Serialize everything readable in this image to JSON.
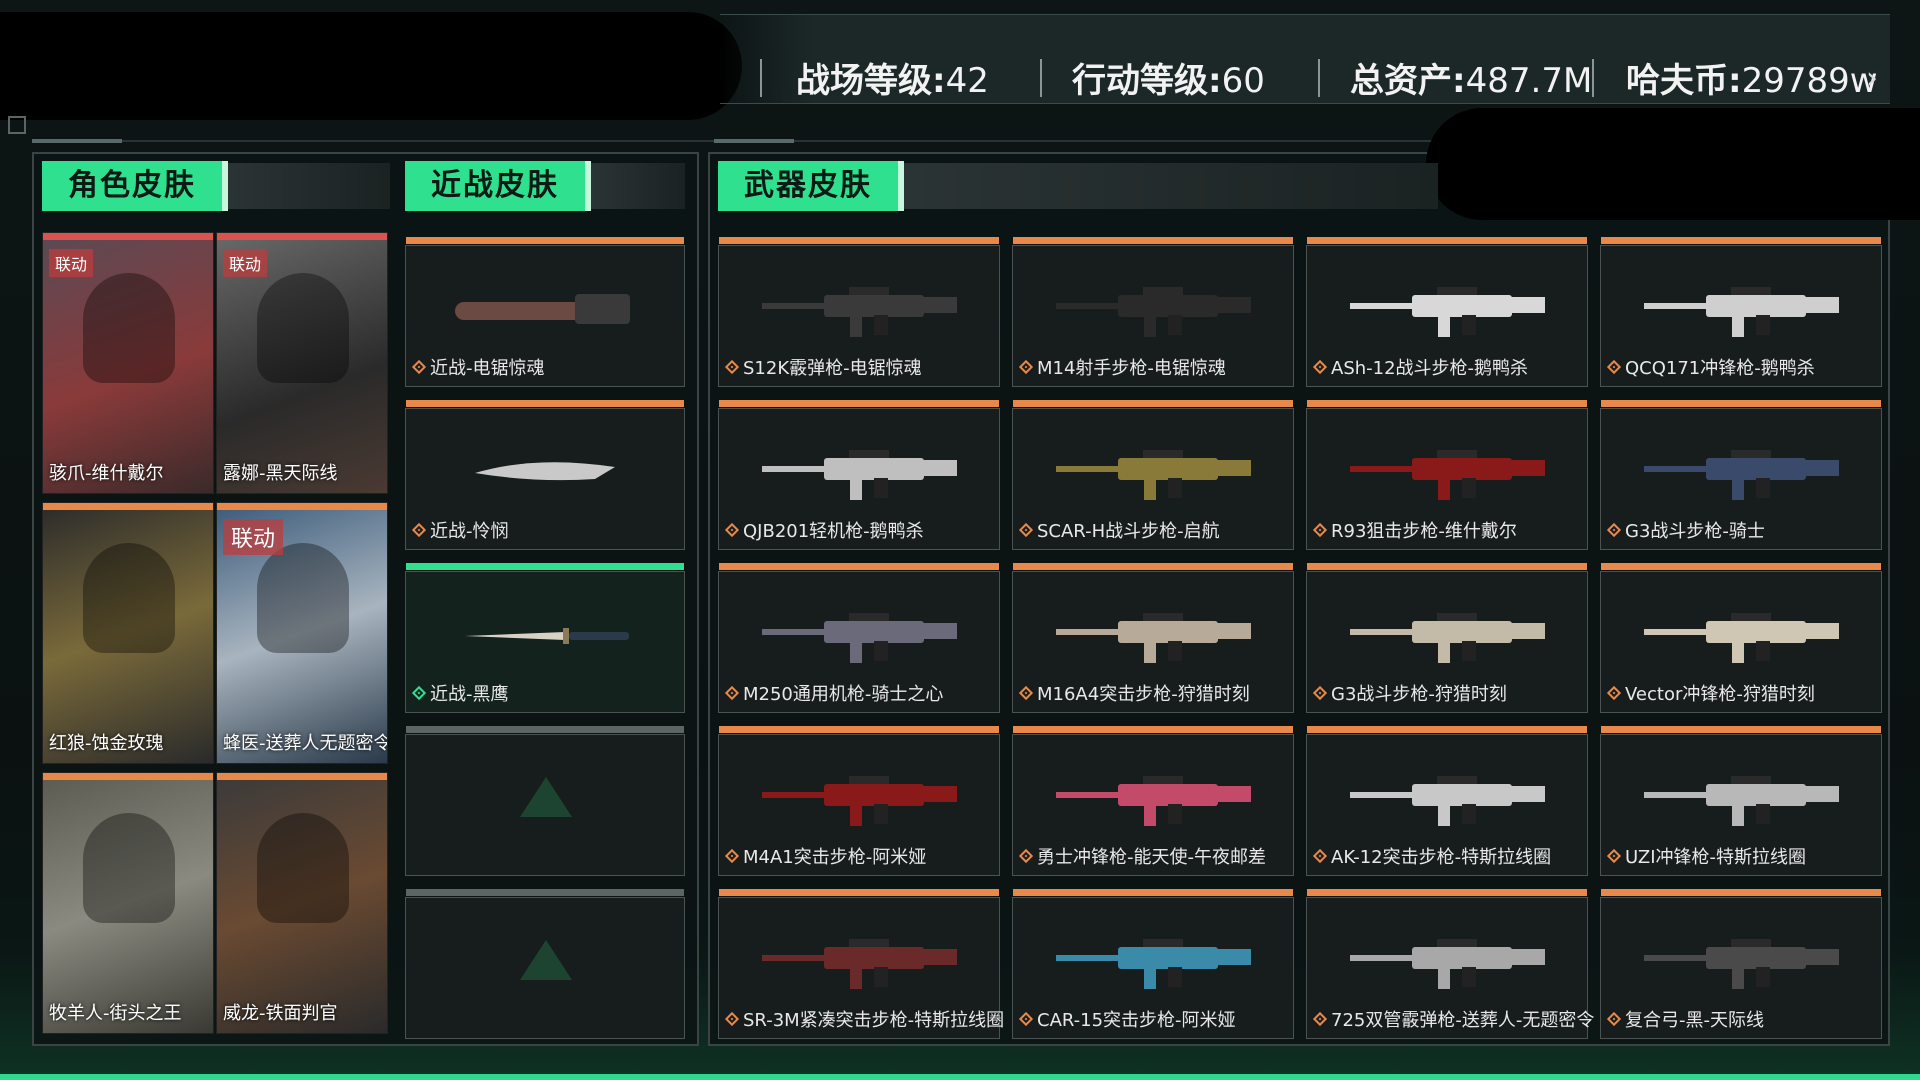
{
  "header": {
    "stats": [
      {
        "label": "战场等级:",
        "value": "42"
      },
      {
        "label": "行动等级:",
        "value": "60"
      },
      {
        "label": "总资产:",
        "value": "487.7M"
      },
      {
        "label": "哈夫币:",
        "value": "29789w"
      }
    ]
  },
  "sections": {
    "character": "角色皮肤",
    "melee": "近战皮肤",
    "weapon": "武器皮肤"
  },
  "colors": {
    "accent": "#2fe08f",
    "rarity_red": "#d9534f",
    "rarity_orange": "#e8894a",
    "rarity_green": "#2fe08f",
    "rarity_gray": "#5c6464"
  },
  "characters": [
    {
      "name": "骇爪-维什戴尔",
      "badge": "联动",
      "rarity": "red"
    },
    {
      "name": "露娜-黑天际线",
      "badge": "联动",
      "rarity": "red"
    },
    {
      "name": "红狼-蚀金玫瑰",
      "badge": "",
      "rarity": "orange"
    },
    {
      "name": "蜂医-送葬人无题密令",
      "badge": "联动",
      "rarity": "orange"
    },
    {
      "name": "牧羊人-街头之王",
      "badge": "",
      "rarity": "orange"
    },
    {
      "name": "威龙-铁面判官",
      "badge": "",
      "rarity": "orange"
    }
  ],
  "melee": [
    {
      "name": "近战-电锯惊魂",
      "rarity": "orange"
    },
    {
      "name": "近战-怜悯",
      "rarity": "orange"
    },
    {
      "name": "近战-黑鹰",
      "rarity": "green"
    },
    {
      "name": "",
      "rarity": "gray"
    },
    {
      "name": "",
      "rarity": "gray"
    }
  ],
  "weapons": [
    {
      "name": "S12K霰弹枪-电锯惊魂"
    },
    {
      "name": "M14射手步枪-电锯惊魂"
    },
    {
      "name": "ASh-12战斗步枪-鹅鸭杀"
    },
    {
      "name": "QCQ171冲锋枪-鹅鸭杀"
    },
    {
      "name": "QJB201轻机枪-鹅鸭杀"
    },
    {
      "name": "SCAR-H战斗步枪-启航"
    },
    {
      "name": "R93狙击步枪-维什戴尔"
    },
    {
      "name": "G3战斗步枪-骑士"
    },
    {
      "name": "M250通用机枪-骑士之心"
    },
    {
      "name": "M16A4突击步枪-狩猎时刻"
    },
    {
      "name": "G3战斗步枪-狩猎时刻"
    },
    {
      "name": "Vector冲锋枪-狩猎时刻"
    },
    {
      "name": "M4A1突击步枪-阿米娅"
    },
    {
      "name": "勇士冲锋枪-能天使-午夜邮差"
    },
    {
      "name": "AK-12突击步枪-特斯拉线圈"
    },
    {
      "name": "UZI冲锋枪-特斯拉线圈"
    },
    {
      "name": "SR-3M紧凑突击步枪-特斯拉线圈"
    },
    {
      "name": "CAR-15突击步枪-阿米娅"
    },
    {
      "name": "725双管霰弹枪-送葬人-无题密令"
    },
    {
      "name": "复合弓-黑-天际线"
    }
  ]
}
